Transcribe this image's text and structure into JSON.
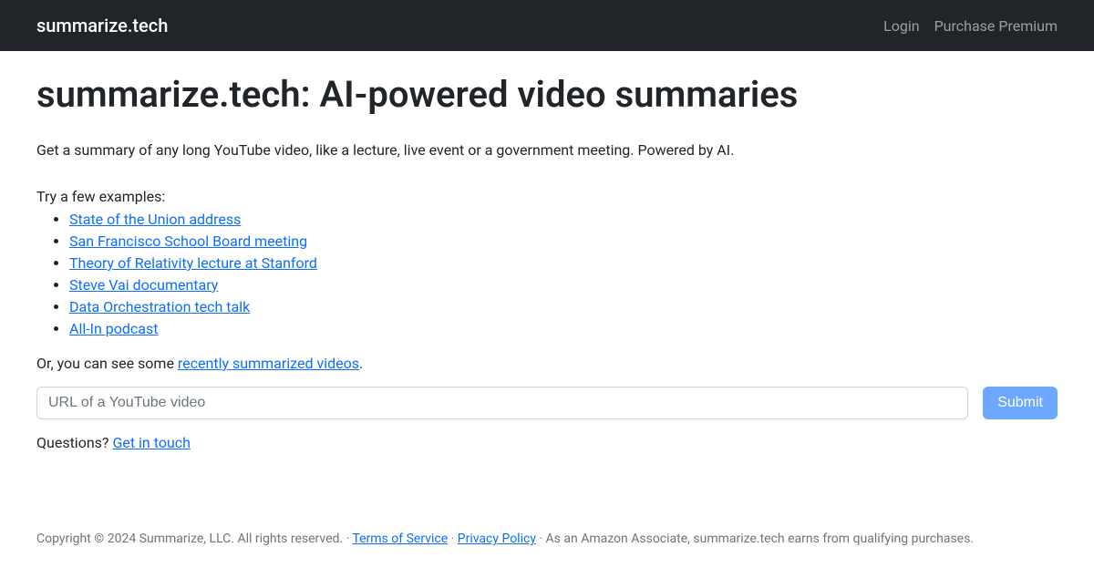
{
  "navbar": {
    "brand": "summarize.tech",
    "login": "Login",
    "premium": "Purchase Premium"
  },
  "main": {
    "heading": "summarize.tech: AI-powered video summaries",
    "description": "Get a summary of any long YouTube video, like a lecture, live event or a government meeting. Powered by AI.",
    "examples_intro": "Try a few examples:",
    "examples": [
      "State of the Union address",
      "San Francisco School Board meeting",
      "Theory of Relativity lecture at Stanford",
      "Steve Vai documentary",
      "Data Orchestration tech talk",
      "All-In podcast"
    ],
    "recent_prefix": "Or, you can see some ",
    "recent_link": "recently summarized videos",
    "recent_suffix": ".",
    "url_placeholder": "URL of a YouTube video",
    "submit_label": "Submit",
    "questions_prefix": "Questions? ",
    "questions_link": "Get in touch"
  },
  "footer": {
    "copyright_prefix": "Copyright © 2024 Summarize, LLC. All rights reserved. · ",
    "tos": "Terms of Service",
    "sep1": " · ",
    "privacy": "Privacy Policy",
    "suffix": " · As an Amazon Associate, summarize.tech earns from qualifying purchases."
  }
}
